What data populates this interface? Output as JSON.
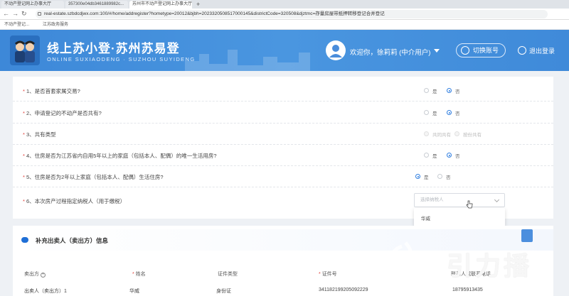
{
  "browser": {
    "tabs": [
      {
        "label": "不动产登记网上办事大厅"
      },
      {
        "label": "357300e04db3461889982c..."
      },
      {
        "label": "苏州市不动产登记网上办事大厅"
      }
    ],
    "url": "real-estate.szbdcdjwx.com:100/#/home/addregister?hometype=20012&bjbh=2023320508517000145&districtCode=320508&djztmc=存量房屋带抵押转移登记合并登记",
    "bookmarks": [
      "不动产登记...",
      "江苏政务服务"
    ]
  },
  "header": {
    "title": "线上苏小登·苏州苏易登",
    "subtitle": "ONLINE SUXIAODENG · SUZHOU SUYIDENG",
    "welcome": "欢迎你，徐莉莉 (中介用户)",
    "switch_account": "切换账号",
    "logout": "退出登录"
  },
  "questions": [
    {
      "text": "1、是否首套家属交易?",
      "options": [
        "是",
        "否"
      ],
      "selected": 1,
      "disabled": false
    },
    {
      "text": "2、申请登记的不动产是否共有?",
      "options": [
        "是",
        "否"
      ],
      "selected": 1,
      "disabled": false
    },
    {
      "text": "3、共有类型",
      "options": [
        "共同共有",
        "按份共有"
      ],
      "selected": -1,
      "disabled": true
    },
    {
      "text": "4、住房是否为江苏省内自用5年以上的家庭（包括本人、配偶）的唯一生活用房?",
      "options": [
        "是",
        "否"
      ],
      "selected": 1,
      "disabled": false
    },
    {
      "text": "5、住房是否为2年以上家庭（包括本人、配偶）生活住房?",
      "options": [
        "是",
        "否"
      ],
      "selected": 0,
      "disabled": false
    },
    {
      "text": "6、本次房产过程指定纳税人（用于缴税）",
      "options": [],
      "selected": -1,
      "disabled": false
    }
  ],
  "taxpayer_select": {
    "placeholder": "选择纳税人",
    "options": [
      "华威"
    ]
  },
  "seller_section": {
    "title": "补充出卖人（卖出方）信息",
    "columns": [
      "卖出方",
      "姓名",
      "证件类型",
      "证件号",
      "联系人或联系电话"
    ],
    "rows": [
      [
        "出卖人（卖出方）1",
        "华威",
        "身份证",
        "341182199205092229",
        "18795913435"
      ]
    ]
  },
  "watermark": "引力播",
  "colors": {
    "header_blue": "#3d88d8",
    "accent": "#2f7ee0",
    "required": "#e0413b"
  }
}
